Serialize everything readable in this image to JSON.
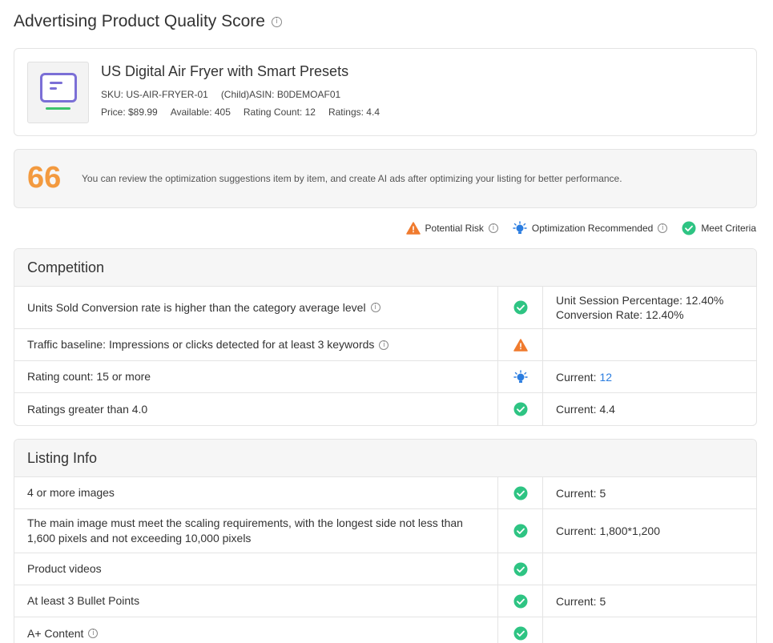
{
  "page": {
    "title": "Advertising Product Quality Score"
  },
  "product": {
    "name": "US Digital Air Fryer with Smart Presets",
    "sku": "SKU: US-AIR-FRYER-01",
    "asin": "(Child)ASIN: B0DEMOAF01",
    "price": "Price: $89.99",
    "available": "Available: 405",
    "rating_count": "Rating Count: 12",
    "ratings": "Ratings: 4.4"
  },
  "score": {
    "value": "66",
    "message": "You can review the optimization suggestions item by item, and create AI ads after optimizing your listing for better performance."
  },
  "legend": {
    "risk": "Potential Risk",
    "optimize": "Optimization Recommended",
    "meet": "Meet Criteria"
  },
  "colors": {
    "risk": "#f07b2e",
    "optimize": "#2b7de0",
    "meet": "#2ec483",
    "score": "#f39a3f"
  },
  "competition": {
    "title": "Competition",
    "rows": [
      {
        "desc": "Units Sold Conversion rate is higher than the category average level",
        "status": "meet",
        "value1": "Unit Session Percentage: 12.40%",
        "value2": "Conversion Rate: 12.40%"
      },
      {
        "desc": "Traffic baseline: Impressions or clicks detected for at least 3 keywords",
        "status": "risk"
      },
      {
        "desc": "Rating count: 15 or more",
        "status": "optimize",
        "value_prefix": "Current: ",
        "value_link": "12"
      },
      {
        "desc": "Ratings greater than 4.0",
        "status": "meet",
        "value1": "Current: 4.4"
      }
    ]
  },
  "listing": {
    "title": "Listing Info",
    "rows": [
      {
        "desc": "4 or more images",
        "status": "meet",
        "value1": "Current: 5"
      },
      {
        "desc": "The main image must meet the scaling requirements, with the longest side not less than 1,600 pixels and not exceeding 10,000 pixels",
        "status": "meet",
        "value1": "Current: 1,800*1,200"
      },
      {
        "desc": "Product videos",
        "status": "meet"
      },
      {
        "desc": "At least 3 Bullet Points",
        "status": "meet",
        "value1": "Current: 5"
      },
      {
        "desc": "A+ Content",
        "status": "meet"
      }
    ]
  }
}
